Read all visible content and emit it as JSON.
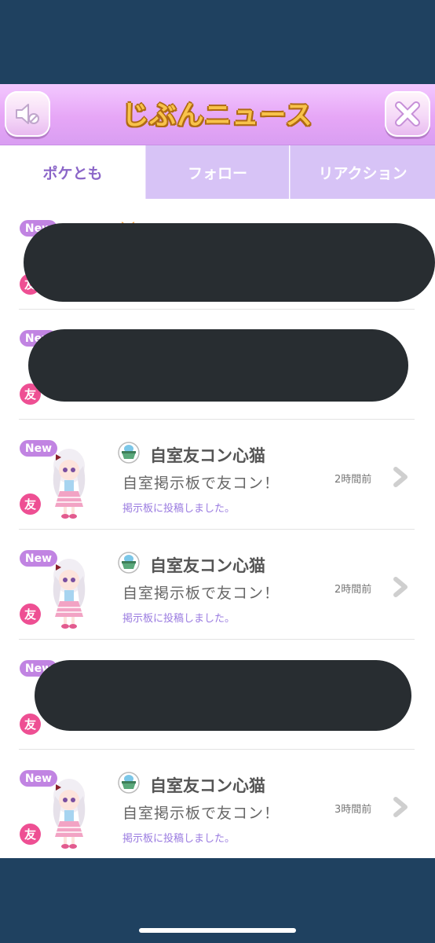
{
  "header": {
    "title": "じぶんニュース",
    "sound_icon": "speaker-muted-icon",
    "close_icon": "close-icon"
  },
  "tabs": [
    {
      "label": "ポケとも",
      "active": true
    },
    {
      "label": "フォロー",
      "active": false
    },
    {
      "label": "リアクション",
      "active": false
    }
  ],
  "colors": {
    "background": "#1f4160",
    "header_gradient_top": "#f3c8ff",
    "tab_inactive": "#d7c3f6",
    "tab_active_text": "#8b66c8",
    "new_badge": "#c184e2",
    "friend_badge": "#ee4f93",
    "link_text": "#9a7be0",
    "redaction": "#282d31"
  },
  "news_items": [
    {
      "new_label": "New",
      "friend_label": "友",
      "redacted": true
    },
    {
      "new_label": "New",
      "friend_label": "友",
      "redacted": true
    },
    {
      "new_label": "New",
      "friend_label": "友",
      "redacted": false,
      "user_name": "自室友コン心猫",
      "message": "自室掲示板で友コン！",
      "time": "2時間前",
      "subtext": "掲示板に投稿しました。"
    },
    {
      "new_label": "New",
      "friend_label": "友",
      "redacted": false,
      "user_name": "自室友コン心猫",
      "message": "自室掲示板で友コン！",
      "time": "2時間前",
      "subtext": "掲示板に投稿しました。"
    },
    {
      "new_label": "New",
      "friend_label": "友",
      "redacted": true
    },
    {
      "new_label": "New",
      "friend_label": "友",
      "redacted": false,
      "user_name": "自室友コン心猫",
      "message": "自室掲示板で友コン！",
      "time": "3時間前",
      "subtext": "掲示板に投稿しました。"
    }
  ]
}
